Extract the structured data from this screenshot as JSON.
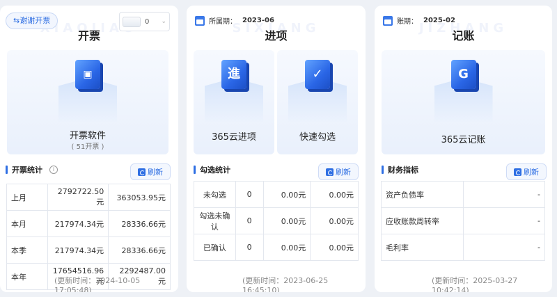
{
  "invoice": {
    "switch_label": "⇆谢谢开票",
    "dropdown_value": "0",
    "watermark": "XIAOJIAO",
    "title": "开票",
    "software_label": "开票软件",
    "software_sub": "( 51开票 )",
    "section_title": "开票统计",
    "refresh_label": "刷新",
    "rows": [
      {
        "label": "上月",
        "v1": "2792722.50元",
        "v2": "363053.95元"
      },
      {
        "label": "本月",
        "v1": "217974.34元",
        "v2": "28336.66元"
      },
      {
        "label": "本季",
        "v1": "217974.34元",
        "v2": "28336.66元"
      },
      {
        "label": "本年",
        "v1": "17654516.96元",
        "v2": "2292487.00元"
      }
    ],
    "updated": "(更新时间：2024-10-05 17:05:48)"
  },
  "purchase": {
    "period_label": "所属期：",
    "period_value": "2023-06",
    "watermark": "SIXIANG",
    "title": "进项",
    "product1": "365云进项",
    "product2": "快速勾选",
    "section_title": "勾选统计",
    "refresh_label": "刷新",
    "rows": [
      {
        "label": "未勾选",
        "count": "0",
        "v1": "0.00元",
        "v2": "0.00元"
      },
      {
        "label": "勾选未确认",
        "count": "0",
        "v1": "0.00元",
        "v2": "0.00元"
      },
      {
        "label": "已确认",
        "count": "0",
        "v1": "0.00元",
        "v2": "0.00元"
      }
    ],
    "updated": "(更新时间：2023-06-25 16:45:10)"
  },
  "accounting": {
    "period_label": "账期：",
    "period_value": "2025-02",
    "watermark": "JIZHANG",
    "title": "记账",
    "product": "365云记账",
    "section_title": "财务指标",
    "refresh_label": "刷新",
    "rows": [
      {
        "label": "资产负债率",
        "value": "-"
      },
      {
        "label": "应收账款周转率",
        "value": "-"
      },
      {
        "label": "毛利率",
        "value": "-"
      }
    ],
    "updated": "(更新时间：2025-03-27 10:42:14)"
  },
  "colors": {
    "accent": "#2f6fe3",
    "background": "#eef1f6",
    "card": "#ffffff"
  }
}
